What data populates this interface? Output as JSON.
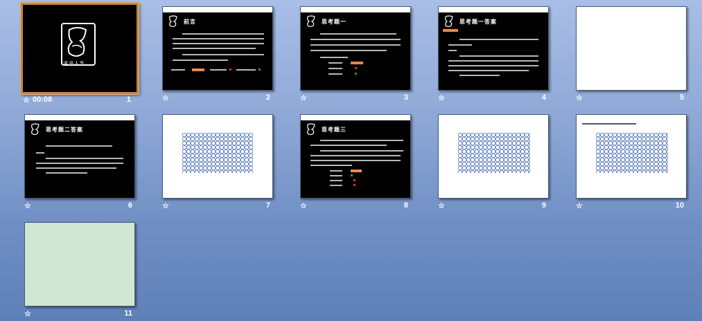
{
  "slides": [
    {
      "num": "1",
      "timing": "00:08",
      "star": "☆",
      "caption": "读书人生"
    },
    {
      "num": "2",
      "star": "☆",
      "title": "前言"
    },
    {
      "num": "3",
      "star": "☆",
      "title": "思考题一"
    },
    {
      "num": "4",
      "star": "☆",
      "title": "思考题一答案"
    },
    {
      "num": "5",
      "star": "☆"
    },
    {
      "num": "6",
      "star": "☆",
      "title": "思考题二答案"
    },
    {
      "num": "7",
      "star": "☆"
    },
    {
      "num": "8",
      "star": "☆",
      "title": "思考题三"
    },
    {
      "num": "9",
      "star": "☆"
    },
    {
      "num": "10",
      "star": "☆"
    },
    {
      "num": "11",
      "star": "☆"
    }
  ],
  "colors": {
    "background_top": "#a9bee6",
    "background_bottom": "#5e80b8",
    "selection_border": "#c98444",
    "accent_orange": "#e98a4a",
    "mesh_blue": "#5a7ab8",
    "green_slide": "#cfe6d3"
  },
  "icons": {
    "star": "animation-star-icon",
    "logo": "book-logo-icon"
  }
}
